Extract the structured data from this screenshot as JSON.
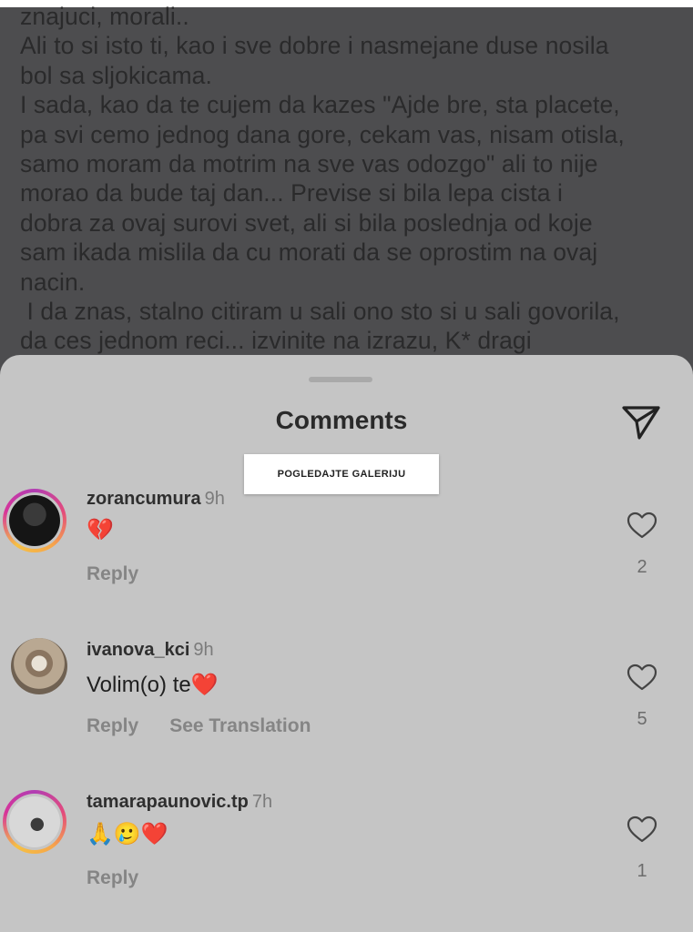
{
  "post": {
    "lines": [
      "znajuci, morali..",
      "Ali to si isto ti, kao i sve dobre i nasmejane duse nosila",
      "bol sa sljokicama.",
      "I sada, kao da te cujem da kazes \"Ajde bre, sta placete,",
      "pa svi cemo jednog dana gore, cekam vas, nisam otisla,",
      "samo moram da motrim na sve vas odozgo\" ali to nije",
      "morao da bude taj dan... Previse si bila lepa cista i",
      "dobra za ovaj surovi svet, ali si bila poslednja od koje",
      "sam ikada mislila da cu morati da se oprostim na ovaj",
      "nacin.",
      " I da znas, stalno citiram u sali ono sto si u sali govorila,",
      "da ces jednom reci... izvinite na izrazu, K* dragi"
    ]
  },
  "sheet": {
    "title": "Comments",
    "share_icon": "paper-plane-icon"
  },
  "overlay": {
    "gallery_label": "POGLEDAJTE GALERIJU"
  },
  "comments": [
    {
      "username": "zorancumura",
      "time": "9h",
      "text": "💔",
      "actions": [
        "Reply"
      ],
      "likes": "2",
      "avatar_ring": true
    },
    {
      "username": "ivanova_kci",
      "time": "9h",
      "text": "Volim(o) te❤️",
      "actions": [
        "Reply",
        "See Translation"
      ],
      "likes": "5",
      "avatar_ring": false
    },
    {
      "username": "tamarapaunovic.tp",
      "time": "7h",
      "text": "🙏🥲❤️",
      "actions": [
        "Reply"
      ],
      "likes": "1",
      "avatar_ring": true
    }
  ],
  "colors": {
    "backdrop": "#4d4d4f",
    "sheet": "#c5c5c5",
    "heart_red": "#d8312f"
  }
}
